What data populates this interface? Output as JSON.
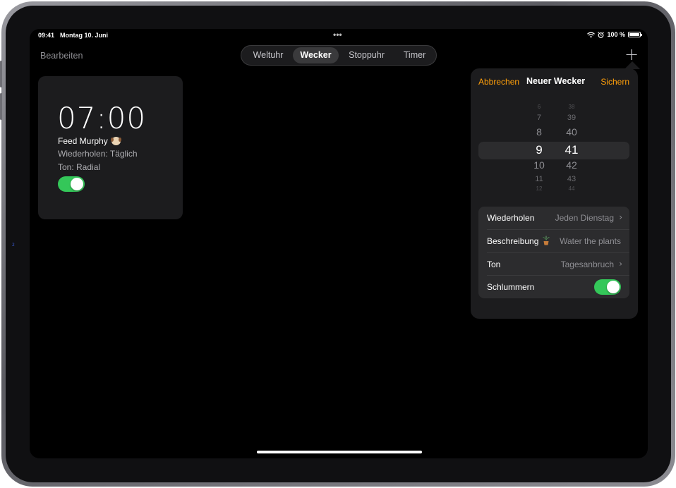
{
  "status_bar": {
    "time": "09:41",
    "date": "Montag 10. Juni",
    "battery": "100 %",
    "dots": "•••"
  },
  "nav": {
    "edit_label": "Bearbeiten",
    "tabs": [
      {
        "label": "Weltuhr"
      },
      {
        "label": "Wecker",
        "active": true
      },
      {
        "label": "Stoppuhr"
      },
      {
        "label": "Timer"
      }
    ],
    "add_label": "+"
  },
  "alarm": {
    "time": "07:00",
    "title": "Feed Murphy",
    "repeat": "Wiederholen: Täglich",
    "sound": "Ton: Radial",
    "enabled": true
  },
  "popover": {
    "cancel_label": "Abbrechen",
    "title": "Neuer Wecker",
    "save_label": "Sichern",
    "picker": {
      "hours": [
        "6",
        "7",
        "8",
        "9",
        "10",
        "11",
        "12"
      ],
      "minutes": [
        "38",
        "39",
        "40",
        "41",
        "42",
        "43",
        "44"
      ],
      "selected_hour": "9",
      "selected_minute": "41"
    },
    "settings": {
      "repeat": {
        "label": "Wiederholen",
        "value": "Jeden Dienstag"
      },
      "description": {
        "label": "Beschreibung",
        "value": "Water the plants"
      },
      "sound": {
        "label": "Ton",
        "value": "Tagesanbruch"
      },
      "snooze": {
        "label": "Schlummern",
        "enabled": true
      }
    }
  },
  "colors": {
    "accent": "#ff9f0a",
    "toggle_on": "#34c759",
    "background": "#000000",
    "card": "#1c1c1e"
  },
  "side_marker": "2"
}
